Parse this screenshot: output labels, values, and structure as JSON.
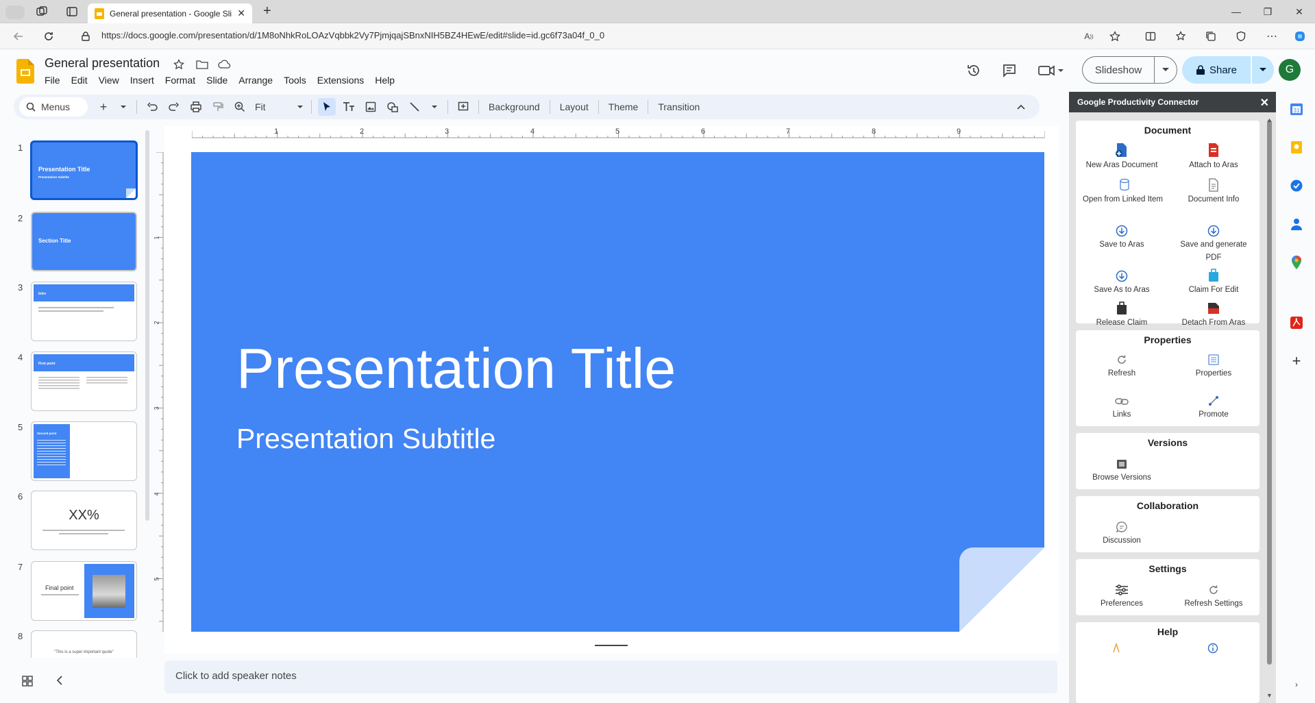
{
  "browser": {
    "tab_title": "General presentation - Google Sli",
    "url": "https://docs.google.com/presentation/d/1M8oNhkRoLOAzVqbbk2Vy7PjmjqajSBnxNIH5BZ4HEwE/edit#slide=id.gc6f73a04f_0_0"
  },
  "app": {
    "doc_title": "General presentation",
    "menus": [
      "File",
      "Edit",
      "View",
      "Insert",
      "Format",
      "Slide",
      "Arrange",
      "Tools",
      "Extensions",
      "Help"
    ],
    "slideshow_label": "Slideshow",
    "share_label": "Share",
    "avatar_letter": "G",
    "accent": "#0b57d0",
    "slide_color": "#4285f4"
  },
  "toolbar": {
    "search_label": "Menus",
    "zoom_label": "Fit",
    "background_label": "Background",
    "layout_label": "Layout",
    "theme_label": "Theme",
    "transition_label": "Transition"
  },
  "ruler": {
    "h_marks": [
      "1",
      "2",
      "3",
      "4",
      "5",
      "6",
      "7",
      "8",
      "9"
    ],
    "v_marks": [
      "1",
      "2",
      "3",
      "4",
      "5"
    ]
  },
  "filmstrip": {
    "slides": [
      {
        "num": "1",
        "title": "Presentation Title",
        "subtitle": "Presentation Subtitle"
      },
      {
        "num": "2",
        "title": "Section Title"
      },
      {
        "num": "3",
        "title": "Intro"
      },
      {
        "num": "4",
        "title": "First point"
      },
      {
        "num": "5",
        "title": "Second point"
      },
      {
        "num": "6",
        "title": "XX%"
      },
      {
        "num": "7",
        "title": "Final point"
      },
      {
        "num": "8",
        "title": "\"This is a super important quote\""
      }
    ]
  },
  "slide": {
    "title": "Presentation Title",
    "subtitle": "Presentation Subtitle"
  },
  "notes": {
    "placeholder": "Click to add speaker notes"
  },
  "panel": {
    "title": "Google Productivity Connector",
    "sections": {
      "document": {
        "title": "Document",
        "actions": [
          "New Aras Document",
          "Attach to Aras",
          "Open from Linked Item",
          "Document Info",
          "Save to Aras",
          "Save and generate PDF",
          "Save As to Aras",
          "Claim For Edit",
          "Release Claim",
          "Detach From Aras"
        ]
      },
      "properties": {
        "title": "Properties",
        "actions": [
          "Refresh",
          "Properties",
          "Links",
          "Promote"
        ]
      },
      "versions": {
        "title": "Versions",
        "actions": [
          "Browse Versions"
        ]
      },
      "collaboration": {
        "title": "Collaboration",
        "actions": [
          "Discussion"
        ]
      },
      "settings": {
        "title": "Settings",
        "actions": [
          "Preferences",
          "Refresh Settings"
        ]
      },
      "help": {
        "title": "Help"
      }
    }
  }
}
